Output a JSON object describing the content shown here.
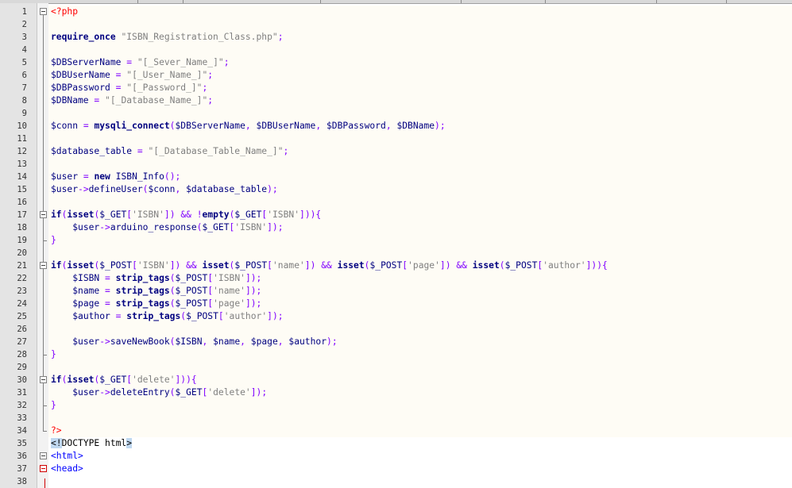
{
  "editor": {
    "lines": [
      {
        "n": "1",
        "segs": [
          [
            "php",
            "<?php"
          ]
        ]
      },
      {
        "n": "2",
        "segs": []
      },
      {
        "n": "3",
        "segs": [
          [
            "kw",
            "require_once"
          ],
          [
            "plain",
            " "
          ],
          [
            "str",
            "\"ISBN_Registration_Class.php\""
          ],
          [
            "op",
            ";"
          ]
        ]
      },
      {
        "n": "4",
        "segs": []
      },
      {
        "n": "5",
        "segs": [
          [
            "var",
            "$DBServerName"
          ],
          [
            "plain",
            " "
          ],
          [
            "op",
            "="
          ],
          [
            "plain",
            " "
          ],
          [
            "str",
            "\"[_Sever_Name_]\""
          ],
          [
            "op",
            ";"
          ]
        ]
      },
      {
        "n": "6",
        "segs": [
          [
            "var",
            "$DBUserName"
          ],
          [
            "plain",
            " "
          ],
          [
            "op",
            "="
          ],
          [
            "plain",
            " "
          ],
          [
            "str",
            "\"[_User_Name_]\""
          ],
          [
            "op",
            ";"
          ]
        ]
      },
      {
        "n": "7",
        "segs": [
          [
            "var",
            "$DBPassword"
          ],
          [
            "plain",
            " "
          ],
          [
            "op",
            "="
          ],
          [
            "plain",
            " "
          ],
          [
            "str",
            "\"[_Password_]\""
          ],
          [
            "op",
            ";"
          ]
        ]
      },
      {
        "n": "8",
        "segs": [
          [
            "var",
            "$DBName"
          ],
          [
            "plain",
            " "
          ],
          [
            "op",
            "="
          ],
          [
            "plain",
            " "
          ],
          [
            "str",
            "\"[_Database_Name_]\""
          ],
          [
            "op",
            ";"
          ]
        ]
      },
      {
        "n": "9",
        "segs": []
      },
      {
        "n": "10",
        "segs": [
          [
            "var",
            "$conn"
          ],
          [
            "plain",
            " "
          ],
          [
            "op",
            "="
          ],
          [
            "plain",
            " "
          ],
          [
            "fn",
            "mysqli_connect"
          ],
          [
            "op",
            "("
          ],
          [
            "var",
            "$DBServerName"
          ],
          [
            "op",
            ","
          ],
          [
            "plain",
            " "
          ],
          [
            "var",
            "$DBUserName"
          ],
          [
            "op",
            ","
          ],
          [
            "plain",
            " "
          ],
          [
            "var",
            "$DBPassword"
          ],
          [
            "op",
            ","
          ],
          [
            "plain",
            " "
          ],
          [
            "var",
            "$DBName"
          ],
          [
            "op",
            ");"
          ]
        ]
      },
      {
        "n": "11",
        "segs": []
      },
      {
        "n": "12",
        "segs": [
          [
            "var",
            "$database_table"
          ],
          [
            "plain",
            " "
          ],
          [
            "op",
            "="
          ],
          [
            "plain",
            " "
          ],
          [
            "str",
            "\"[_Database_Table_Name_]\""
          ],
          [
            "op",
            ";"
          ]
        ]
      },
      {
        "n": "13",
        "segs": []
      },
      {
        "n": "14",
        "segs": [
          [
            "var",
            "$user"
          ],
          [
            "plain",
            " "
          ],
          [
            "op",
            "="
          ],
          [
            "plain",
            " "
          ],
          [
            "kw",
            "new"
          ],
          [
            "plain",
            " "
          ],
          [
            "var",
            "ISBN_Info"
          ],
          [
            "op",
            "();"
          ]
        ]
      },
      {
        "n": "15",
        "segs": [
          [
            "var",
            "$user"
          ],
          [
            "op",
            "->"
          ],
          [
            "var",
            "defineUser"
          ],
          [
            "op",
            "("
          ],
          [
            "var",
            "$conn"
          ],
          [
            "op",
            ","
          ],
          [
            "plain",
            " "
          ],
          [
            "var",
            "$database_table"
          ],
          [
            "op",
            ");"
          ]
        ]
      },
      {
        "n": "16",
        "segs": []
      },
      {
        "n": "17",
        "segs": [
          [
            "kw",
            "if"
          ],
          [
            "op",
            "("
          ],
          [
            "kw",
            "isset"
          ],
          [
            "op",
            "("
          ],
          [
            "var",
            "$_GET"
          ],
          [
            "op",
            "["
          ],
          [
            "str",
            "'ISBN'"
          ],
          [
            "op",
            "])"
          ],
          [
            "plain",
            " "
          ],
          [
            "op",
            "&&"
          ],
          [
            "plain",
            " "
          ],
          [
            "op",
            "!"
          ],
          [
            "kw",
            "empty"
          ],
          [
            "op",
            "("
          ],
          [
            "var",
            "$_GET"
          ],
          [
            "op",
            "["
          ],
          [
            "str",
            "'ISBN'"
          ],
          [
            "op",
            "])){"
          ]
        ]
      },
      {
        "n": "18",
        "segs": [
          [
            "plain",
            "    "
          ],
          [
            "var",
            "$user"
          ],
          [
            "op",
            "->"
          ],
          [
            "var",
            "arduino_response"
          ],
          [
            "op",
            "("
          ],
          [
            "var",
            "$_GET"
          ],
          [
            "op",
            "["
          ],
          [
            "str",
            "'ISBN'"
          ],
          [
            "op",
            "]);"
          ]
        ]
      },
      {
        "n": "19",
        "segs": [
          [
            "op",
            "}"
          ]
        ]
      },
      {
        "n": "20",
        "segs": []
      },
      {
        "n": "21",
        "segs": [
          [
            "kw",
            "if"
          ],
          [
            "op",
            "("
          ],
          [
            "kw",
            "isset"
          ],
          [
            "op",
            "("
          ],
          [
            "var",
            "$_POST"
          ],
          [
            "op",
            "["
          ],
          [
            "str",
            "'ISBN'"
          ],
          [
            "op",
            "])"
          ],
          [
            "plain",
            " "
          ],
          [
            "op",
            "&&"
          ],
          [
            "plain",
            " "
          ],
          [
            "kw",
            "isset"
          ],
          [
            "op",
            "("
          ],
          [
            "var",
            "$_POST"
          ],
          [
            "op",
            "["
          ],
          [
            "str",
            "'name'"
          ],
          [
            "op",
            "])"
          ],
          [
            "plain",
            " "
          ],
          [
            "op",
            "&&"
          ],
          [
            "plain",
            " "
          ],
          [
            "kw",
            "isset"
          ],
          [
            "op",
            "("
          ],
          [
            "var",
            "$_POST"
          ],
          [
            "op",
            "["
          ],
          [
            "str",
            "'page'"
          ],
          [
            "op",
            "])"
          ],
          [
            "plain",
            " "
          ],
          [
            "op",
            "&&"
          ],
          [
            "plain",
            " "
          ],
          [
            "kw",
            "isset"
          ],
          [
            "op",
            "("
          ],
          [
            "var",
            "$_POST"
          ],
          [
            "op",
            "["
          ],
          [
            "str",
            "'author'"
          ],
          [
            "op",
            "])){"
          ]
        ]
      },
      {
        "n": "22",
        "segs": [
          [
            "plain",
            "    "
          ],
          [
            "var",
            "$ISBN"
          ],
          [
            "plain",
            " "
          ],
          [
            "op",
            "="
          ],
          [
            "plain",
            " "
          ],
          [
            "fn",
            "strip_tags"
          ],
          [
            "op",
            "("
          ],
          [
            "var",
            "$_POST"
          ],
          [
            "op",
            "["
          ],
          [
            "str",
            "'ISBN'"
          ],
          [
            "op",
            "]);"
          ]
        ]
      },
      {
        "n": "23",
        "segs": [
          [
            "plain",
            "    "
          ],
          [
            "var",
            "$name"
          ],
          [
            "plain",
            " "
          ],
          [
            "op",
            "="
          ],
          [
            "plain",
            " "
          ],
          [
            "fn",
            "strip_tags"
          ],
          [
            "op",
            "("
          ],
          [
            "var",
            "$_POST"
          ],
          [
            "op",
            "["
          ],
          [
            "str",
            "'name'"
          ],
          [
            "op",
            "]);"
          ]
        ]
      },
      {
        "n": "24",
        "segs": [
          [
            "plain",
            "    "
          ],
          [
            "var",
            "$page"
          ],
          [
            "plain",
            " "
          ],
          [
            "op",
            "="
          ],
          [
            "plain",
            " "
          ],
          [
            "fn",
            "strip_tags"
          ],
          [
            "op",
            "("
          ],
          [
            "var",
            "$_POST"
          ],
          [
            "op",
            "["
          ],
          [
            "str",
            "'page'"
          ],
          [
            "op",
            "]);"
          ]
        ]
      },
      {
        "n": "25",
        "segs": [
          [
            "plain",
            "    "
          ],
          [
            "var",
            "$author"
          ],
          [
            "plain",
            " "
          ],
          [
            "op",
            "="
          ],
          [
            "plain",
            " "
          ],
          [
            "fn",
            "strip_tags"
          ],
          [
            "op",
            "("
          ],
          [
            "var",
            "$_POST"
          ],
          [
            "op",
            "["
          ],
          [
            "str",
            "'author'"
          ],
          [
            "op",
            "]);"
          ]
        ]
      },
      {
        "n": "26",
        "segs": []
      },
      {
        "n": "27",
        "segs": [
          [
            "plain",
            "    "
          ],
          [
            "var",
            "$user"
          ],
          [
            "op",
            "->"
          ],
          [
            "var",
            "saveNewBook"
          ],
          [
            "op",
            "("
          ],
          [
            "var",
            "$ISBN"
          ],
          [
            "op",
            ","
          ],
          [
            "plain",
            " "
          ],
          [
            "var",
            "$name"
          ],
          [
            "op",
            ","
          ],
          [
            "plain",
            " "
          ],
          [
            "var",
            "$page"
          ],
          [
            "op",
            ","
          ],
          [
            "plain",
            " "
          ],
          [
            "var",
            "$author"
          ],
          [
            "op",
            ");"
          ]
        ]
      },
      {
        "n": "28",
        "segs": [
          [
            "op",
            "}"
          ]
        ]
      },
      {
        "n": "29",
        "segs": []
      },
      {
        "n": "30",
        "segs": [
          [
            "kw",
            "if"
          ],
          [
            "op",
            "("
          ],
          [
            "kw",
            "isset"
          ],
          [
            "op",
            "("
          ],
          [
            "var",
            "$_GET"
          ],
          [
            "op",
            "["
          ],
          [
            "str",
            "'delete'"
          ],
          [
            "op",
            "])){"
          ]
        ]
      },
      {
        "n": "31",
        "segs": [
          [
            "plain",
            "    "
          ],
          [
            "var",
            "$user"
          ],
          [
            "op",
            "->"
          ],
          [
            "var",
            "deleteEntry"
          ],
          [
            "op",
            "("
          ],
          [
            "var",
            "$_GET"
          ],
          [
            "op",
            "["
          ],
          [
            "str",
            "'delete'"
          ],
          [
            "op",
            "]);"
          ]
        ]
      },
      {
        "n": "32",
        "segs": [
          [
            "op",
            "}"
          ]
        ]
      },
      {
        "n": "33",
        "segs": []
      },
      {
        "n": "34",
        "segs": [
          [
            "php",
            "?>"
          ]
        ]
      },
      {
        "n": "35",
        "segs": [
          [
            "hl",
            "<!"
          ],
          [
            "plain",
            "DOCTYPE html"
          ],
          [
            "hl",
            ">"
          ]
        ]
      },
      {
        "n": "36",
        "segs": [
          [
            "tag",
            "<html>"
          ]
        ]
      },
      {
        "n": "37",
        "segs": [
          [
            "tag",
            "<head>"
          ]
        ]
      },
      {
        "n": "38",
        "segs": []
      }
    ]
  }
}
